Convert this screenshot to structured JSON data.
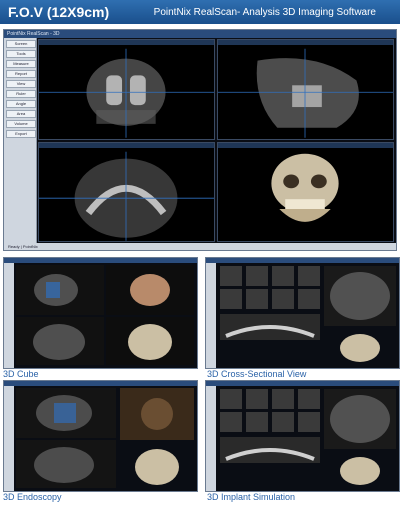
{
  "banner": {
    "title": "F.O.V (12X9cm)",
    "subtitle": "PointNix RealScan- Analysis 3D Imaging Software"
  },
  "main": {
    "window_title": "PointNix RealScan - 3D",
    "tools": [
      "Screen",
      "Tools",
      "Measure",
      "Report",
      "View",
      "Ruler",
      "Angle",
      "Area",
      "Volume",
      "Export"
    ],
    "status": "Ready | PointNix"
  },
  "captions": {
    "cube": "3D Cube",
    "cross": "3D Cross-Sectional View",
    "endo": "3D Endoscopy",
    "implant": "3D Implant Simulation"
  },
  "colors": {
    "accent": "#2b63a8",
    "banner": "#2f6fb1"
  }
}
